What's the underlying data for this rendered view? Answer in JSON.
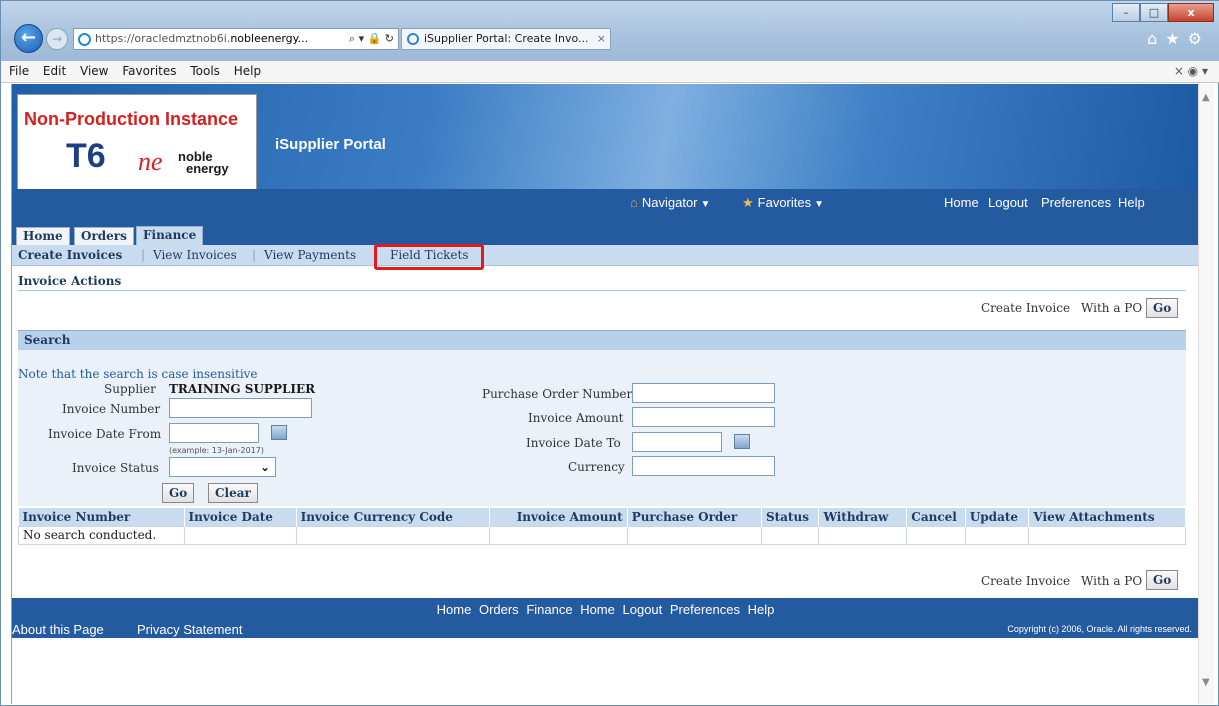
{
  "browser": {
    "address_prefix": "https://oracledmztnob6i.",
    "address_host": "nobleenergy...",
    "address_tools": "⌕ ▾ 🔒 ↻",
    "tab_title": "iSupplier Portal: Create Invo...",
    "tab_close": "×",
    "window_buttons": {
      "minimize": "–",
      "maximize": "□",
      "close": "x"
    },
    "chrome_icons": "⌂★⚙",
    "menu": [
      "File",
      "Edit",
      "View",
      "Favorites",
      "Tools",
      "Help"
    ],
    "menu_right": "×  ◉ ▾"
  },
  "banner": {
    "non_production": "Non-Production Instance",
    "instance": "T6",
    "logo_ne": "ne",
    "logo_noble": "noble",
    "logo_energy": "energy",
    "portal_title": "iSupplier Portal"
  },
  "navbar": {
    "navigator": "Navigator",
    "favorites": "Favorites",
    "global_links": [
      "Home",
      "Logout",
      "Preferences",
      "Help"
    ]
  },
  "tabs": [
    "Home",
    "Orders",
    "Finance"
  ],
  "active_tab": "Finance",
  "subtabs": [
    "Create Invoices",
    "View Invoices",
    "View Payments",
    "Field Tickets"
  ],
  "invoice_actions": {
    "title": "Invoice Actions",
    "create_label": "Create Invoice",
    "with_po": "With a PO",
    "go": "Go"
  },
  "search": {
    "title": "Search",
    "note": "Note that the search is case insensitive",
    "supplier_label": "Supplier",
    "supplier_value": "TRAINING SUPPLIER",
    "invoice_number_label": "Invoice Number",
    "invoice_date_from_label": "Invoice Date From",
    "date_hint": "(example: 13-Jan-2017)",
    "invoice_status_label": "Invoice Status",
    "po_number_label": "Purchase Order Number",
    "invoice_amount_label": "Invoice Amount",
    "invoice_date_to_label": "Invoice Date To",
    "currency_label": "Currency",
    "go": "Go",
    "clear": "Clear"
  },
  "results": {
    "columns": [
      "Invoice Number",
      "Invoice Date",
      "Invoice Currency Code",
      "Invoice Amount",
      "Purchase Order",
      "Status",
      "Withdraw",
      "Cancel",
      "Update",
      "View Attachments"
    ],
    "empty_message": "No search conducted."
  },
  "footer": {
    "links": [
      "Home",
      "Orders",
      "Finance",
      "Home",
      "Logout",
      "Preferences",
      "Help"
    ],
    "about": "About this Page",
    "privacy": "Privacy Statement",
    "copyright": "Copyright (c) 2006, Oracle. All rights reserved."
  },
  "colors": {
    "accent": "#245aa0",
    "highlight": "#e21a1a",
    "band": "#c9dcef"
  }
}
